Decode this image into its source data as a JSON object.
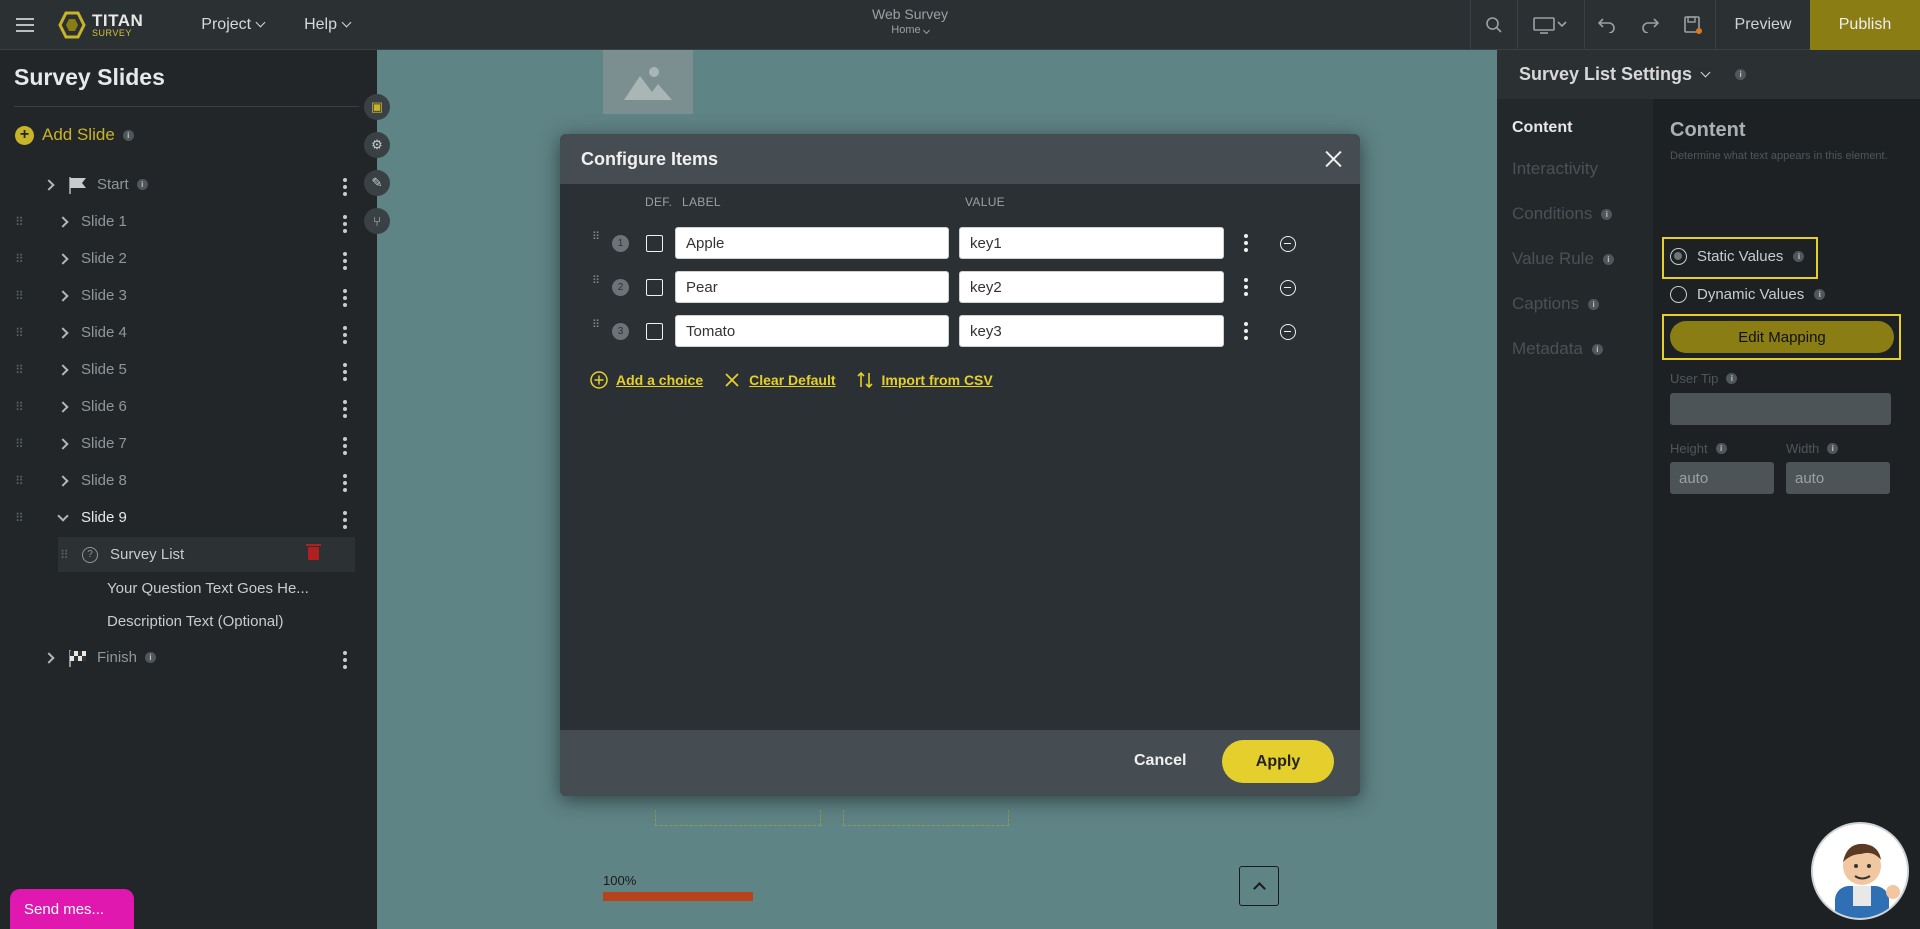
{
  "app": {
    "logo_title": "TITAN",
    "logo_subtitle": "SURVEY",
    "menu": [
      "Project",
      "Help"
    ],
    "doc_title": "Web Survey",
    "doc_page": "Home",
    "preview_label": "Preview",
    "publish_label": "Publish"
  },
  "sidebar": {
    "title": "Survey Slides",
    "add_slide_label": "Add Slide",
    "slides": [
      {
        "label": "Start",
        "active": false
      },
      {
        "label": "Slide 1",
        "active": false
      },
      {
        "label": "Slide 2",
        "active": false
      },
      {
        "label": "Slide 3",
        "active": false
      },
      {
        "label": "Slide 4",
        "active": false
      },
      {
        "label": "Slide 5",
        "active": false
      },
      {
        "label": "Slide 6",
        "active": false
      },
      {
        "label": "Slide 7",
        "active": false
      },
      {
        "label": "Slide 8",
        "active": false
      },
      {
        "label": "Slide 9",
        "active": true
      }
    ],
    "selected_element": "Survey List",
    "children": [
      "Your Question Text Goes He...",
      "Description Text (Optional)"
    ],
    "finish_label": "Finish"
  },
  "canvas": {
    "progress_label": "100%",
    "progress_value": 1.0
  },
  "modal": {
    "title": "Configure Items",
    "col_def": "DEF.",
    "col_label": "LABEL",
    "col_value": "VALUE",
    "items": [
      {
        "num": "1",
        "label": "Apple",
        "value": "key1"
      },
      {
        "num": "2",
        "label": "Pear",
        "value": "key2"
      },
      {
        "num": "3",
        "label": "Tomato",
        "value": "key3"
      }
    ],
    "add_choice": "Add a choice",
    "clear_default": "Clear Default",
    "import_csv": "Import from CSV",
    "cancel_label": "Cancel",
    "apply_label": "Apply"
  },
  "right_panel": {
    "header": "Survey List Settings",
    "nav": [
      "Content",
      "Interactivity",
      "Conditions",
      "Value Rule",
      "Captions",
      "Metadata"
    ],
    "content_title": "Content",
    "content_desc": "Determine what text appears in this element.",
    "static_values": "Static Values",
    "dynamic_values": "Dynamic Values",
    "edit_mapping": "Edit Mapping",
    "user_tip_label": "User Tip",
    "height_label": "Height",
    "height_value": "auto",
    "width_label": "Width",
    "width_value": "auto"
  },
  "chat": {
    "label": "Send mes..."
  }
}
